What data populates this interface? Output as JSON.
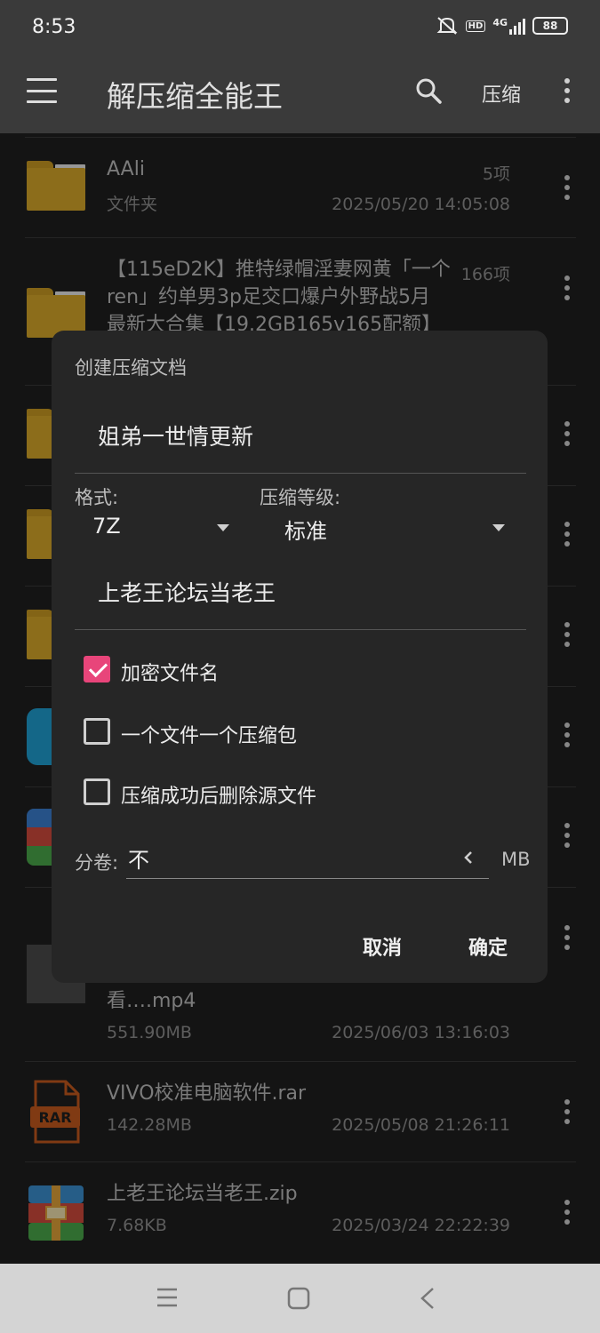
{
  "status": {
    "time": "8:53",
    "network": "4G",
    "hd": "HD",
    "battery": "88"
  },
  "app": {
    "title": "解压缩全能王",
    "compress_label": "压缩"
  },
  "files": [
    {
      "name": "AAli",
      "sub": "文件夹",
      "count": "5项",
      "date": "2025/05/20 14:05:08"
    },
    {
      "name_lines": [
        "【115eD2K】推特绿帽淫妻网黄「一个",
        "ren」约单男3p足交口爆户外野战5月",
        "最新大合集【19.2GB165v165配额】"
      ],
      "count": "166项"
    },
    {
      "name_tail": "看….mp4",
      "size": "551.90MB",
      "date": "2025/06/03 13:16:03"
    },
    {
      "name": "VIVO校准电脑软件.rar",
      "size": "142.28MB",
      "date": "2025/05/08 21:26:11",
      "badge": "RAR"
    },
    {
      "name": "上老王论坛当老王.zip",
      "size": "7.68KB",
      "date": "2025/03/24 22:22:39"
    }
  ],
  "dialog": {
    "title": "创建压缩文档",
    "filename": "姐弟一世情更新",
    "format_label": "格式:",
    "format_value": "7Z",
    "level_label": "压缩等级:",
    "level_value": "标准",
    "password": "上老王论坛当老王",
    "options": [
      {
        "label": "加密文件名",
        "checked": true
      },
      {
        "label": "一个文件一个压缩包",
        "checked": false
      },
      {
        "label": "压缩成功后删除源文件",
        "checked": false
      }
    ],
    "split_label": "分卷:",
    "split_value": "不",
    "split_unit": "MB",
    "cancel": "取消",
    "ok": "确定"
  },
  "colors": {
    "accent": "#e8457a",
    "folder": "#d7a82a",
    "appbar": "#3a3a3a",
    "background": "#1f1f1f",
    "dialog": "#262626"
  }
}
